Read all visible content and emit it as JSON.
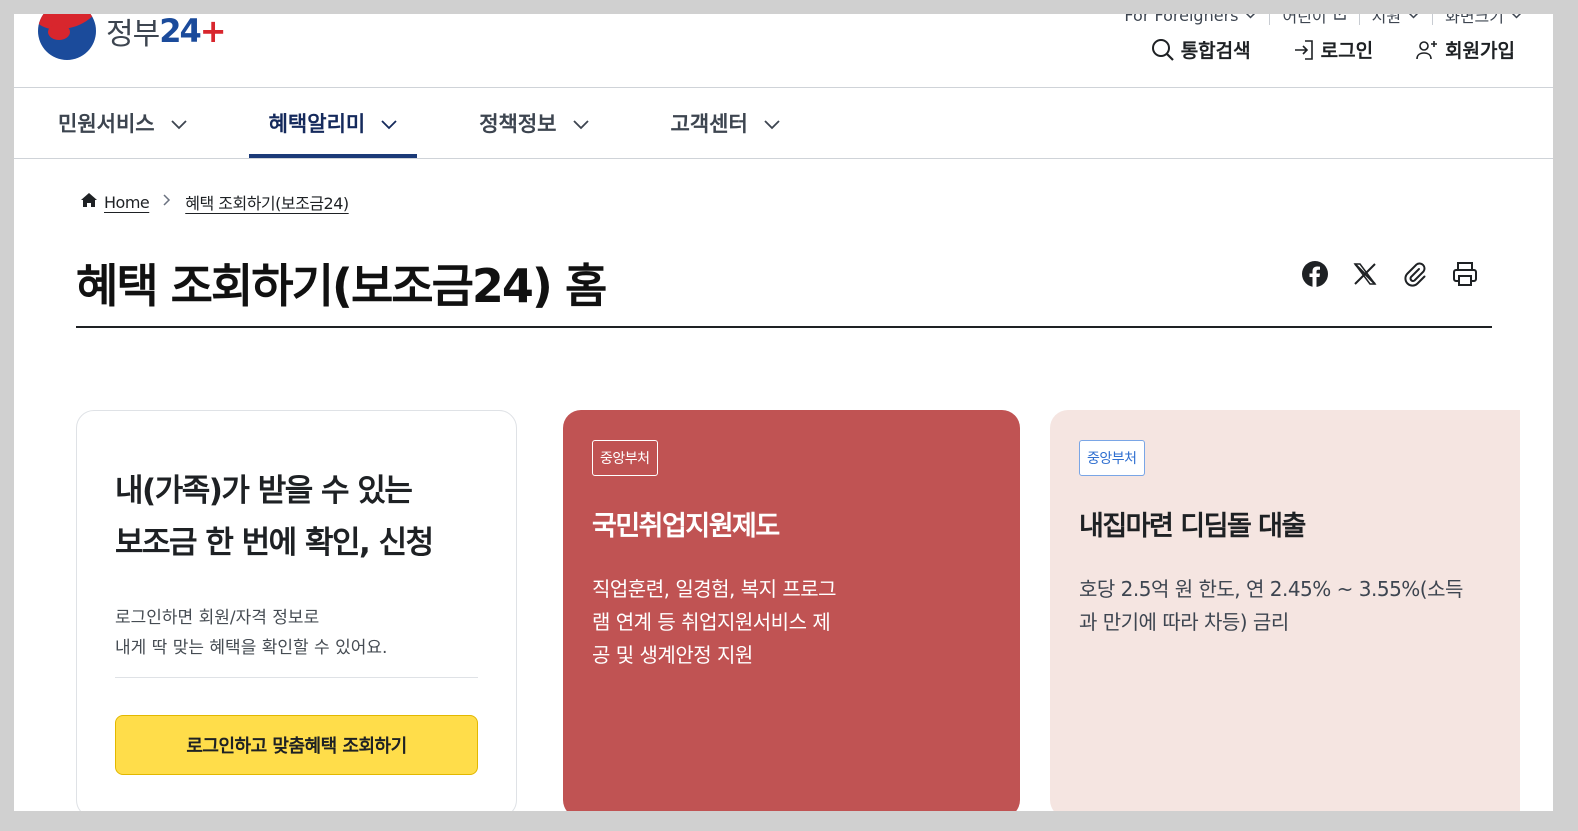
{
  "header": {
    "logo_text": "정부",
    "logo_number": "24",
    "logo_plus": "+",
    "utility": [
      {
        "label": "For Foreigners"
      },
      {
        "label": "어린이"
      },
      {
        "label": "지원"
      },
      {
        "label": "화면크기"
      }
    ],
    "actions": {
      "search": "통합검색",
      "login": "로그인",
      "signup": "회원가입"
    }
  },
  "gnb": {
    "items": [
      {
        "label": "민원서비스"
      },
      {
        "label": "혜택알리미"
      },
      {
        "label": "정책정보"
      },
      {
        "label": "고객센터"
      }
    ],
    "active_index": 1
  },
  "breadcrumb": {
    "home": "Home",
    "current": "혜택 조회하기(보조금24)"
  },
  "page": {
    "title": "혜택 조회하기(보조금24) 홈",
    "share_icons": [
      "facebook-icon",
      "x-icon",
      "link-clip-icon",
      "print-icon"
    ]
  },
  "cards": {
    "login": {
      "title_line1": "내(가족)가 받을 수 있는",
      "title_line2": "보조금 한 번에 확인, 신청",
      "desc_line1": "로그인하면 회원/자격 정보로",
      "desc_line2": "내게 딱 맞는 혜택을 확인할 수 있어요.",
      "button": "로그인하고 맞춤혜택 조회하기"
    },
    "items": [
      {
        "tag": "중앙부처",
        "title": "국민취업지원제도",
        "desc": "직업훈련, 일경험, 복지 프로그램 연계 등 취업지원서비스 제공 및 생계안정 지원"
      },
      {
        "tag": "중앙부처",
        "title": "내집마련 디딤돌 대출",
        "desc": "호당 2.5억 원 한도, 연 2.45% ~ 3.55%(소득과 만기에 따라 차등) 금리"
      }
    ]
  },
  "colors": {
    "accent_navy": "#1b3a78",
    "button_yellow": "#ffdd4a",
    "card_red": "#c05353",
    "card_pink": "#f5e5e1",
    "tag_blue": "#2f6fd0"
  }
}
